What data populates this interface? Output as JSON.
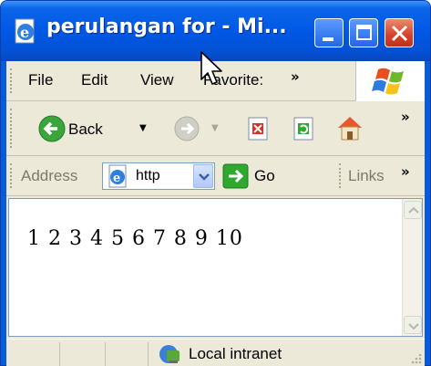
{
  "window": {
    "title": "perulangan for - Mi..."
  },
  "menubar": {
    "items": [
      "File",
      "Edit",
      "View",
      "Favorite:"
    ],
    "overflow": "»"
  },
  "toolbar": {
    "back_label": "Back",
    "overflow": "»"
  },
  "addressbar": {
    "label": "Address",
    "value": "http",
    "go_label": "Go",
    "links_label": "Links",
    "overflow": "»"
  },
  "content": {
    "text": "1 2 3 4 5 6 7 8 9 10"
  },
  "statusbar": {
    "zone": "Local intranet"
  },
  "colors": {
    "titlebar": "#0058e6",
    "chrome": "#ece9d8",
    "close": "#d4412a",
    "go_arrow": "#2fa82f"
  }
}
